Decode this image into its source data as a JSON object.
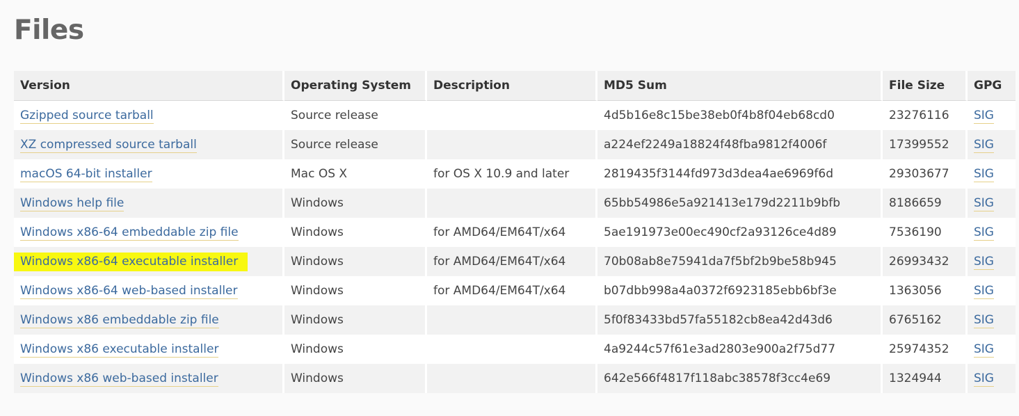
{
  "page": {
    "title": "Files"
  },
  "table": {
    "headers": [
      "Version",
      "Operating System",
      "Description",
      "MD5 Sum",
      "File Size",
      "GPG"
    ],
    "rows": [
      {
        "version": "Gzipped source tarball",
        "os": "Source release",
        "description": "",
        "md5": "4d5b16e8c15be38eb0f4b8f04eb68cd0",
        "size": "23276116",
        "gpg": "SIG",
        "highlighted": false
      },
      {
        "version": "XZ compressed source tarball",
        "os": "Source release",
        "description": "",
        "md5": "a224ef2249a18824f48fba9812f4006f",
        "size": "17399552",
        "gpg": "SIG",
        "highlighted": false
      },
      {
        "version": "macOS 64-bit installer",
        "os": "Mac OS X",
        "description": "for OS X 10.9 and later",
        "md5": "2819435f3144fd973d3dea4ae6969f6d",
        "size": "29303677",
        "gpg": "SIG",
        "highlighted": false
      },
      {
        "version": "Windows help file",
        "os": "Windows",
        "description": "",
        "md5": "65bb54986e5a921413e179d2211b9bfb",
        "size": "8186659",
        "gpg": "SIG",
        "highlighted": false
      },
      {
        "version": "Windows x86-64 embeddable zip file",
        "os": "Windows",
        "description": "for AMD64/EM64T/x64",
        "md5": "5ae191973e00ec490cf2a93126ce4d89",
        "size": "7536190",
        "gpg": "SIG",
        "highlighted": false
      },
      {
        "version": "Windows x86-64 executable installer",
        "os": "Windows",
        "description": "for AMD64/EM64T/x64",
        "md5": "70b08ab8e75941da7f5bf2b9be58b945",
        "size": "26993432",
        "gpg": "SIG",
        "highlighted": true
      },
      {
        "version": "Windows x86-64 web-based installer",
        "os": "Windows",
        "description": "for AMD64/EM64T/x64",
        "md5": "b07dbb998a4a0372f6923185ebb6bf3e",
        "size": "1363056",
        "gpg": "SIG",
        "highlighted": false
      },
      {
        "version": "Windows x86 embeddable zip file",
        "os": "Windows",
        "description": "",
        "md5": "5f0f83433bd57fa55182cb8ea42d43d6",
        "size": "6765162",
        "gpg": "SIG",
        "highlighted": false
      },
      {
        "version": "Windows x86 executable installer",
        "os": "Windows",
        "description": "",
        "md5": "4a9244c57f61e3ad2803e900a2f75d77",
        "size": "25974352",
        "gpg": "SIG",
        "highlighted": false
      },
      {
        "version": "Windows x86 web-based installer",
        "os": "Windows",
        "description": "",
        "md5": "642e566f4817f118abc38578f3cc4e69",
        "size": "1324944",
        "gpg": "SIG",
        "highlighted": false
      }
    ]
  },
  "colors": {
    "link": "#3c6a9e",
    "highlight": "#f8f811",
    "header_bg": "#f0f0f0",
    "row_alt_bg": "#f2f2f2"
  }
}
